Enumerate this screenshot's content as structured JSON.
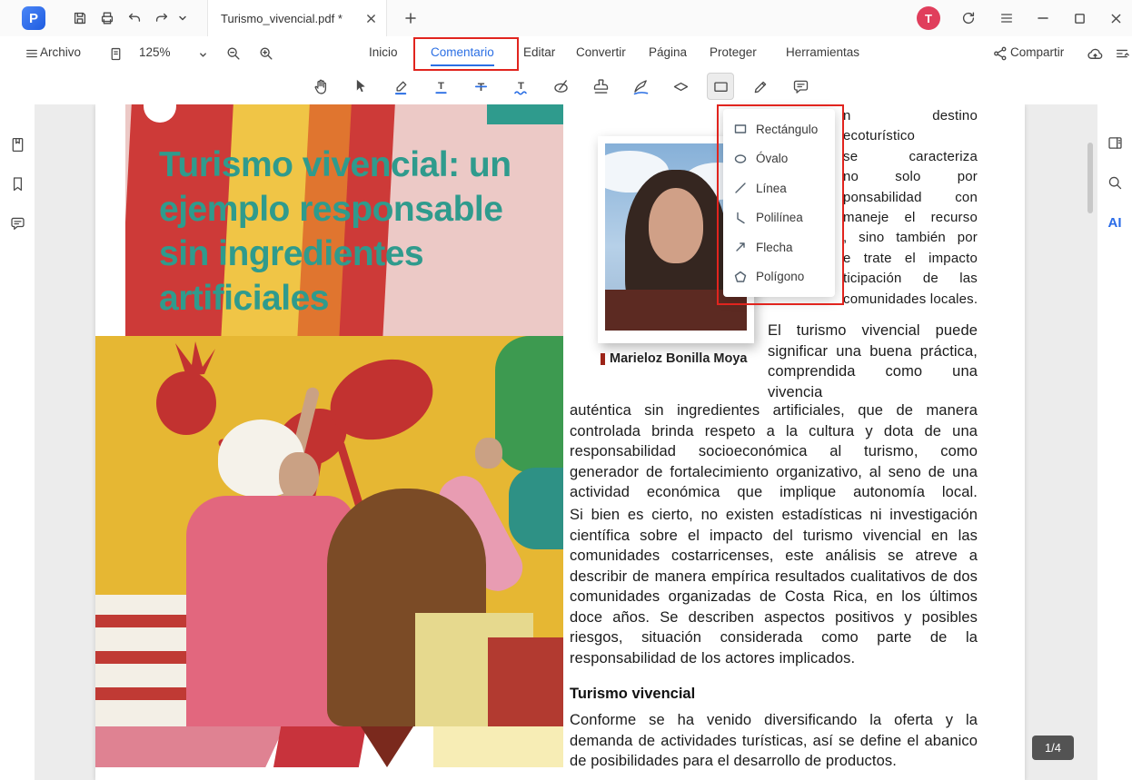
{
  "titlebar": {
    "tab": {
      "title": "Turismo_vivencial.pdf *"
    },
    "avatar": "T"
  },
  "menubar": {
    "archivo": "Archivo",
    "zoom": "125%",
    "tabs": [
      {
        "label": "Inicio"
      },
      {
        "label": "Comentario"
      },
      {
        "label": "Editar"
      },
      {
        "label": "Convertir"
      },
      {
        "label": "Página"
      },
      {
        "label": "Proteger"
      },
      {
        "label": "Herramientas"
      }
    ],
    "active_tab": "Comentario",
    "compartir": "Compartir"
  },
  "sidebar_right": {
    "ai_label": "AI"
  },
  "shape_menu": {
    "items": [
      {
        "label": "Rectángulo",
        "icon": "rectangle-icon"
      },
      {
        "label": "Óvalo",
        "icon": "oval-icon"
      },
      {
        "label": "Línea",
        "icon": "line-icon"
      },
      {
        "label": "Polilínea",
        "icon": "polyline-icon"
      },
      {
        "label": "Flecha",
        "icon": "arrow-icon"
      },
      {
        "label": "Polígono",
        "icon": "polygon-icon"
      }
    ]
  },
  "document": {
    "title_lines": [
      "Turismo vivencial: un",
      "ejemplo responsable",
      "sin ingredientes",
      "artificiales"
    ],
    "portrait_caption": "Marieloz Bonilla Moya",
    "intro_visible_lines": [
      "n destino",
      "ecoturístico",
      "se caracteriza",
      "no solo por",
      "ponsabilidad con",
      "maneje el recurso",
      ", sino también por",
      "e trate el impacto",
      "ticipación de las",
      "comunidades locales."
    ],
    "paragraph_narrow": "El turismo vivencial puede significar una buena práctica, comprendida como una vivencia",
    "paragraph_wide": "auténtica sin ingredientes artificiales, que de manera controlada brinda respeto a la cultura y dota de una responsabilidad socioeconómica al turismo, como generador de fortalecimiento organizativo, al seno de una actividad económica que implique autonomía local.",
    "paragraph_2": "Si bien es cierto, no existen estadísticas ni investigación científica sobre el impacto del turismo vivencial en las comunidades costarricenses, este análisis se atreve a describir de manera empírica resultados cualitativos de dos comunidades organizadas de Costa Rica, en los últimos doce años. Se describen aspectos positivos y posibles riesgos, situación considerada como parte de la responsabilidad de los actores implicados.",
    "section_heading": "Turismo vivencial",
    "paragraph_3": "Conforme se ha venido diversificando la oferta y la demanda de actividades turísticas, así se define el abanico de posibilidades para el desarrollo de productos."
  },
  "status": {
    "page_indicator": "1/4"
  },
  "colors": {
    "accent_blue": "#2b6fe4",
    "annotation_red": "#e1241e",
    "title_teal": "#2f9b8d",
    "avatar_red": "#e03e5c"
  }
}
